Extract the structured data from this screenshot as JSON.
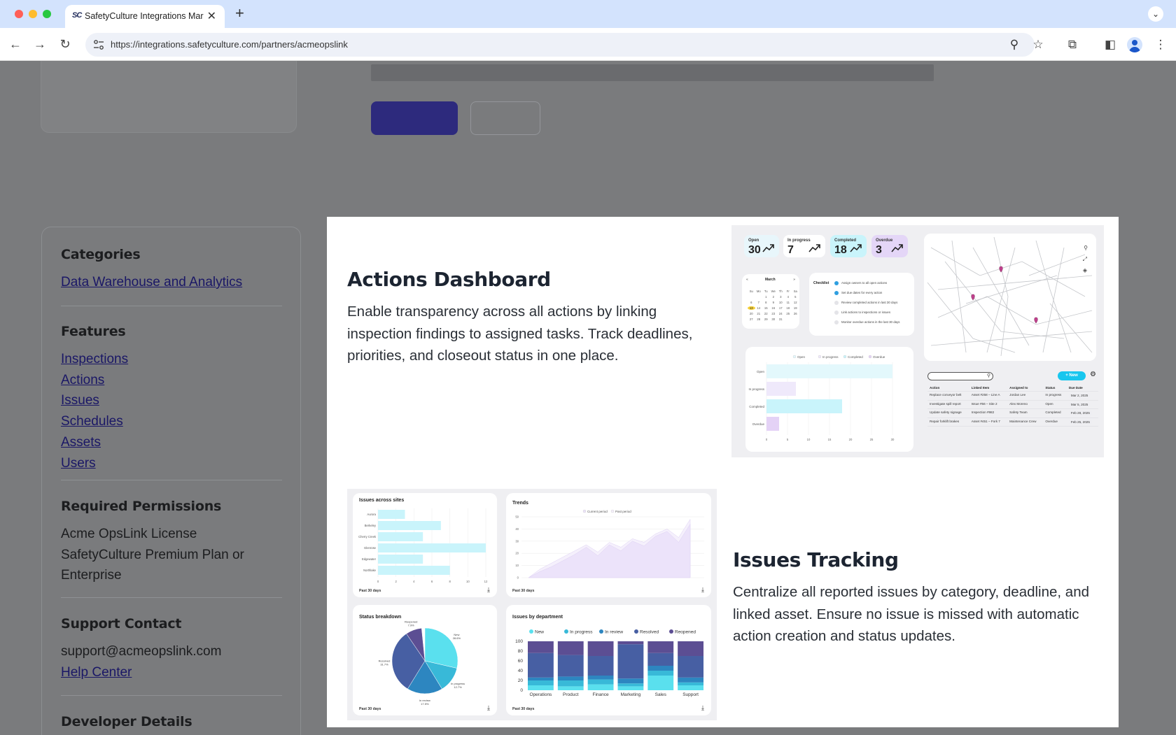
{
  "browser": {
    "tab_title": "SafetyCulture Integrations Market...",
    "tab_favicon_text": "SC",
    "url": "https://integrations.safetyculture.com/partners/acmeopslink"
  },
  "sidebar": {
    "categories": {
      "heading": "Categories",
      "links": [
        "Data Warehouse and Analytics"
      ]
    },
    "features": {
      "heading": "Features",
      "links": [
        "Inspections",
        "Actions",
        "Issues",
        "Schedules",
        "Assets",
        "Users"
      ]
    },
    "permissions": {
      "heading": "Required Permissions",
      "lines": [
        "Acme OpsLink License",
        "SafetyCulture Premium Plan or",
        "Enterprise"
      ]
    },
    "support": {
      "heading": "Support Contact",
      "email": "support@acmeopslink.com",
      "help_link": "Help Center"
    },
    "developer": {
      "heading": "Developer Details"
    }
  },
  "modal": {
    "feature1": {
      "title": "Actions Dashboard",
      "desc_lines": [
        "Enable transparency across all actions by linking",
        "inspection findings to assigned tasks. Track deadlines,",
        "priorities, and closeout status in one place."
      ]
    },
    "feature2": {
      "title": "Issues Tracking",
      "desc_lines": [
        "Centralize all reported issues by category, deadline, and",
        "linked asset. Ensure no issue is missed with automatic",
        "action creation and status updates."
      ]
    }
  },
  "actions_shot": {
    "kpis": [
      {
        "label": "Open",
        "value": "30",
        "color": "#e8f6fb"
      },
      {
        "label": "In progress",
        "value": "7",
        "color": "#ffffff"
      },
      {
        "label": "Completed",
        "value": "18",
        "color": "#c9f4fb"
      },
      {
        "label": "Overdue",
        "value": "3",
        "color": "#e4d6f7"
      }
    ],
    "calendar": {
      "month": "March",
      "weekdays": [
        "Su",
        "Mo",
        "Tu",
        "We",
        "Th",
        "Fr",
        "Sa"
      ],
      "days": [
        "",
        "",
        "1",
        "2",
        "3",
        "4",
        "5",
        "6",
        "7",
        "8",
        "9",
        "10",
        "11",
        "12",
        "13",
        "14",
        "15",
        "16",
        "17",
        "18",
        "19",
        "20",
        "21",
        "22",
        "23",
        "24",
        "25",
        "26",
        "27",
        "28",
        "29",
        "30",
        "31"
      ],
      "highlight_day": "13"
    },
    "checklist": {
      "title": "Checklist",
      "items": [
        {
          "text": "Assign owners to all open actions",
          "done": true
        },
        {
          "text": "Set due dates for every action",
          "done": true
        },
        {
          "text": "Review completed actions in last 30 days",
          "done": false
        },
        {
          "text": "Link actions to inspections or issues",
          "done": false
        },
        {
          "text": "Monitor overdue actions in the last 30 days",
          "done": false
        }
      ]
    },
    "status_chart": {
      "type": "bar",
      "legend": [
        "Open",
        "In progress",
        "Completed",
        "Overdue"
      ],
      "categories": [
        "Open",
        "In progress",
        "Completed",
        "Overdue"
      ],
      "values": [
        30,
        7,
        18,
        3
      ],
      "colors": [
        "#e3f8fc",
        "#efe9fb",
        "#c9f4fb",
        "#e4d2f6"
      ],
      "xticks": [
        "0",
        "5",
        "10",
        "15",
        "20",
        "25",
        "30"
      ],
      "xlim": [
        0,
        30
      ]
    },
    "new_button": "New",
    "table": {
      "headers": [
        "Action",
        "Linked Item",
        "Assigned to",
        "Status",
        "Due Date"
      ],
      "rows": [
        [
          "Replace conveyor belt",
          "Asset #258 – Line A",
          "Jordan Lee",
          "In progress",
          "Mar 2, 2025"
        ],
        [
          "Investigate spill report",
          "Issue #56 – Site 2",
          "Alex Moreno",
          "Open",
          "Mar 5, 2025"
        ],
        [
          "Update safety signage",
          "Inspection #982",
          "Safety Team",
          "Completed",
          "Feb 28, 2025"
        ],
        [
          "Repair forklift brakes",
          "Asset #451 – Fork 7",
          "Maintenance Crew",
          "Overdue",
          "Feb 25, 2025"
        ]
      ]
    }
  },
  "issues_shot": {
    "footer_label": "Past 30 days",
    "sites_chart": {
      "type": "bar",
      "title": "Issues across sites",
      "categories": [
        "Aurora",
        "Berkeley",
        "Cherry Creek",
        "Glenrose",
        "Edgewater",
        "Northlake"
      ],
      "values": [
        3,
        7,
        5,
        12,
        5,
        8
      ],
      "xticks": [
        "0",
        "2",
        "4",
        "6",
        "8",
        "10",
        "12"
      ],
      "xlim": [
        0,
        12
      ],
      "color": "#c9f4fb"
    },
    "trends_chart": {
      "type": "area",
      "title": "Trends",
      "legend": [
        "Current period",
        "Past period"
      ],
      "yticks": [
        "0",
        "10",
        "20",
        "30",
        "40",
        "50"
      ],
      "ylim": [
        0,
        50
      ],
      "current": [
        0,
        5,
        9,
        14,
        19,
        25,
        18,
        27,
        22,
        30,
        26,
        34,
        38,
        29,
        44
      ],
      "past": [
        0,
        7,
        12,
        17,
        22,
        27,
        21,
        29,
        25,
        32,
        29,
        36,
        40,
        33,
        48
      ],
      "colors": [
        "#ece3fa",
        "#f5f0fc"
      ]
    },
    "status_pie": {
      "type": "pie",
      "title": "Status breakdown",
      "slices": [
        {
          "label": "New",
          "pct": 28.6,
          "color": "#5ae0ee"
        },
        {
          "label": "In progress",
          "pct": 12.7,
          "color": "#38b9d8"
        },
        {
          "label": "In review",
          "pct": 17.5,
          "color": "#2d86c0"
        },
        {
          "label": "Resolved",
          "pct": 31.7,
          "color": "#475fa3"
        },
        {
          "label": "Reopened",
          "pct": 7.9,
          "color": "#5c4e93"
        }
      ]
    },
    "dept_chart": {
      "type": "bar",
      "title": "Issues by department",
      "legend": [
        "New",
        "In progress",
        "In review",
        "Resolved",
        "Reopened"
      ],
      "colors": [
        "#5ae0ee",
        "#38b9d8",
        "#2d86c0",
        "#475fa3",
        "#5c4e93"
      ],
      "categories": [
        "Operations",
        "Product",
        "Finance",
        "Marketing",
        "Sales",
        "Support"
      ],
      "yticks": [
        "0",
        "20",
        "40",
        "60",
        "80",
        "100"
      ],
      "ylim": [
        0,
        100
      ],
      "series": [
        {
          "name": "New",
          "values": [
            10,
            8,
            12,
            8,
            30,
            10
          ]
        },
        {
          "name": "In progress",
          "values": [
            10,
            12,
            10,
            6,
            10,
            6
          ]
        },
        {
          "name": "In review",
          "values": [
            6,
            8,
            8,
            10,
            10,
            10
          ]
        },
        {
          "name": "Resolved",
          "values": [
            50,
            44,
            40,
            70,
            26,
            44
          ]
        },
        {
          "name": "Reopened",
          "values": [
            24,
            28,
            30,
            6,
            24,
            30
          ]
        }
      ]
    }
  }
}
